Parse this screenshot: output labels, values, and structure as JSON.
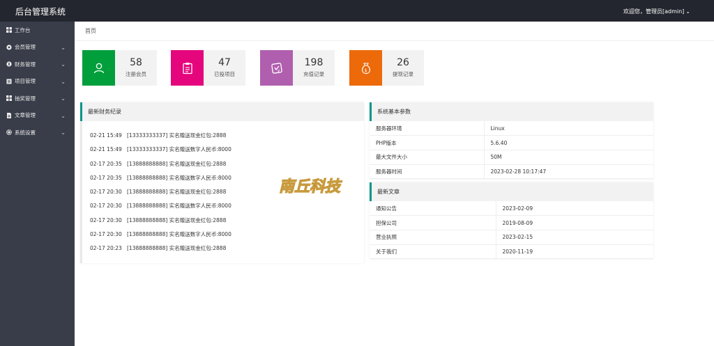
{
  "header": {
    "title": "后台管理系统",
    "user_text": "欢迎您，管理员[admin]"
  },
  "sidebar": {
    "items": [
      {
        "label": "工作台",
        "icon": "dashboard-icon"
      },
      {
        "label": "会员管理",
        "icon": "member-icon"
      },
      {
        "label": "财务管理",
        "icon": "finance-icon"
      },
      {
        "label": "项目管理",
        "icon": "project-icon"
      },
      {
        "label": "抽奖管理",
        "icon": "lottery-icon"
      },
      {
        "label": "文章管理",
        "icon": "article-icon"
      },
      {
        "label": "系统设置",
        "icon": "settings-icon"
      }
    ]
  },
  "breadcrumb": "首页",
  "stats": [
    {
      "value": "58",
      "label": "注册会员",
      "color": "#009f3c",
      "icon": "user-icon"
    },
    {
      "value": "47",
      "label": "已投项目",
      "color": "#e5067d",
      "icon": "clipboard-icon"
    },
    {
      "value": "198",
      "label": "充值记录",
      "color": "#b05fae",
      "icon": "recharge-icon"
    },
    {
      "value": "26",
      "label": "提现记录",
      "color": "#ec6a0a",
      "icon": "money-bag-icon"
    }
  ],
  "finance": {
    "title": "最新财务纪录",
    "records": [
      {
        "time": "02-21 15:49",
        "text": "[13333333337] 实名赠送现金红包:2888"
      },
      {
        "time": "02-21 15:49",
        "text": "[13333333337] 实名赠送数字人民币:8000"
      },
      {
        "time": "02-17 20:35",
        "text": "[13888888888] 实名赠送现金红包:2888"
      },
      {
        "time": "02-17 20:35",
        "text": "[13888888888] 实名赠送数字人民币:8000"
      },
      {
        "time": "02-17 20:30",
        "text": "[13888888888] 实名赠送现金红包:2888"
      },
      {
        "time": "02-17 20:30",
        "text": "[13888888888] 实名赠送数字人民币:8000"
      },
      {
        "time": "02-17 20:30",
        "text": "[13888888888] 实名赠送现金红包:2888"
      },
      {
        "time": "02-17 20:30",
        "text": "[13888888888] 实名赠送数字人民币:8000"
      },
      {
        "time": "02-17 20:23",
        "text": "[13888888888] 实名赠送现金红包:2888"
      }
    ]
  },
  "system": {
    "title": "系统基本参数",
    "rows": [
      {
        "key": "服务器环境",
        "value": "Linux"
      },
      {
        "key": "PHP版本",
        "value": "5.6.40"
      },
      {
        "key": "最大文件大小",
        "value": "50M"
      },
      {
        "key": "服务器时间",
        "value": "2023-02-28 10:17:47"
      }
    ]
  },
  "articles": {
    "title": "最新文章",
    "rows": [
      {
        "key": "通知公告",
        "value": "2023-02-09"
      },
      {
        "key": "担保公司",
        "value": "2019-08-09"
      },
      {
        "key": "营业执照",
        "value": "2023-02-15"
      },
      {
        "key": "关于我们",
        "value": "2020-11-19"
      }
    ]
  },
  "watermark": {
    "text": "南丘科技"
  },
  "colors": {
    "topbar": "#23262e",
    "sidebar": "#393d49",
    "accent": "#009688"
  }
}
